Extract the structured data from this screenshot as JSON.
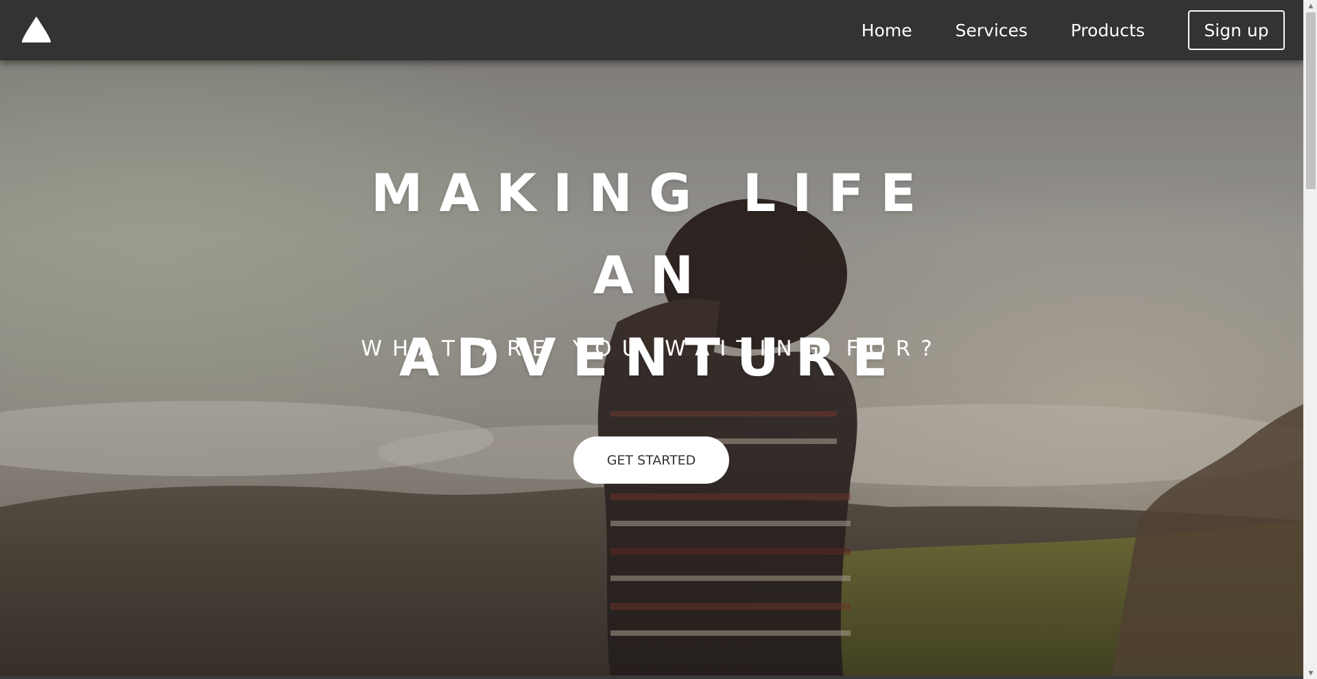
{
  "nav": {
    "logo_icon": "mountain-peak-icon",
    "links": [
      {
        "label": "Home"
      },
      {
        "label": "Services"
      },
      {
        "label": "Products"
      }
    ],
    "signup_label": "Sign up"
  },
  "hero": {
    "title_line1": "MAKING LIFE AN",
    "title_line2": "ADVENTURE",
    "subtitle": "WHAT ARE YOU WAITING FOR?",
    "cta_label": "GET STARTED"
  },
  "colors": {
    "navbar": "#333333",
    "text": "#ffffff",
    "cta_bg": "#ffffff",
    "cta_text": "#333333"
  },
  "scrollbar": {
    "up_icon": "scroll-up-arrow-icon",
    "down_icon": "scroll-down-arrow-icon"
  }
}
